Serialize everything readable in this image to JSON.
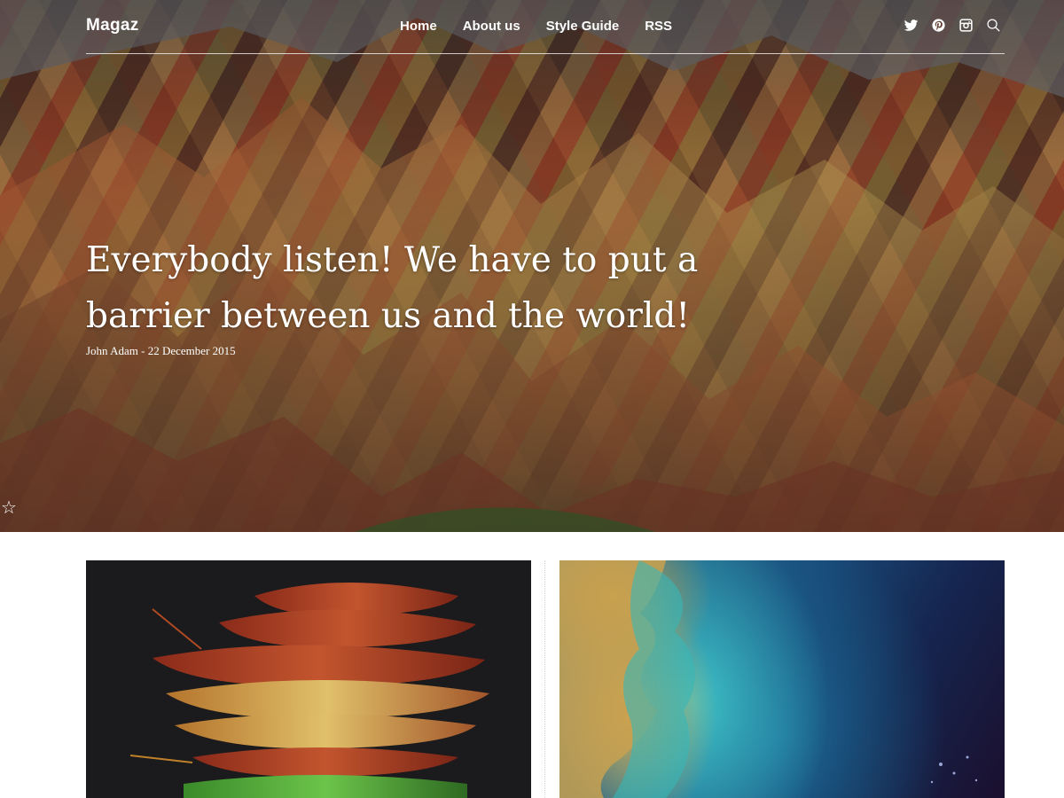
{
  "site": {
    "logo": "Magaz"
  },
  "nav": {
    "items": [
      {
        "label": "Home"
      },
      {
        "label": "About us"
      },
      {
        "label": "Style Guide"
      },
      {
        "label": "RSS"
      }
    ]
  },
  "social": [
    "twitter-icon",
    "pinterest-icon",
    "instagram-icon",
    "search-icon"
  ],
  "hero": {
    "title_line1": "Everybody listen! We have to put a",
    "title_line2": "barrier between us and the world!",
    "meta": "John Adam - 22 December 2015"
  },
  "colors": {
    "header_text": "#ffffff",
    "page_bg": "#ffffff"
  }
}
